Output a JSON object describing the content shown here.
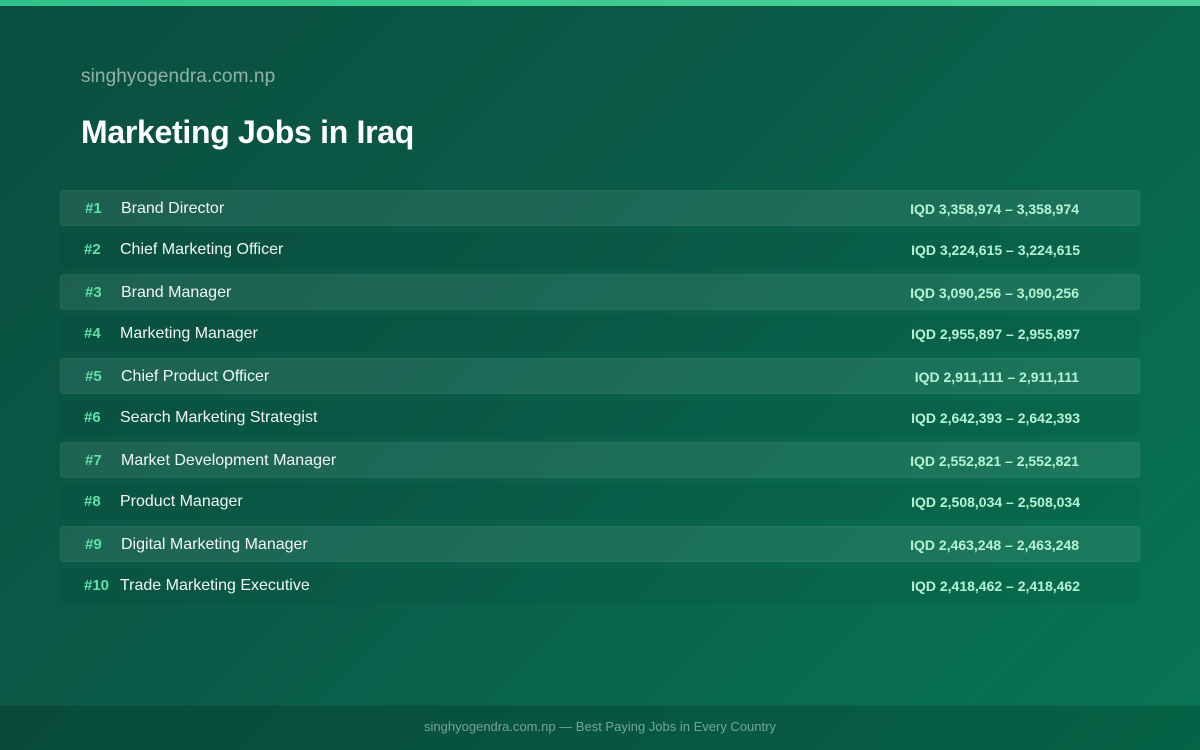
{
  "header": {
    "site_name": "singhyogendra.com.np",
    "title": "Marketing Jobs in Iraq"
  },
  "jobs": [
    {
      "rank": "#1",
      "title": "Brand Director",
      "salary": "IQD 3,358,974 – 3,358,974"
    },
    {
      "rank": "#2",
      "title": "Chief Marketing Officer",
      "salary": "IQD 3,224,615 – 3,224,615"
    },
    {
      "rank": "#3",
      "title": "Brand Manager",
      "salary": "IQD 3,090,256 – 3,090,256"
    },
    {
      "rank": "#4",
      "title": "Marketing Manager",
      "salary": "IQD 2,955,897 – 2,955,897"
    },
    {
      "rank": "#5",
      "title": "Chief Product Officer",
      "salary": "IQD 2,911,111 – 2,911,111"
    },
    {
      "rank": "#6",
      "title": "Search Marketing Strategist",
      "salary": "IQD 2,642,393 – 2,642,393"
    },
    {
      "rank": "#7",
      "title": "Market Development Manager",
      "salary": "IQD 2,552,821 – 2,552,821"
    },
    {
      "rank": "#8",
      "title": "Product Manager",
      "salary": "IQD 2,508,034 – 2,508,034"
    },
    {
      "rank": "#9",
      "title": "Digital Marketing Manager",
      "salary": "IQD 2,463,248 – 2,463,248"
    },
    {
      "rank": "#10",
      "title": "Trade Marketing Executive",
      "salary": "IQD 2,418,462 – 2,418,462"
    }
  ],
  "footer": {
    "text": "singhyogendra.com.np — Best Paying Jobs in Every Country"
  },
  "colors": {
    "background": "#0a5c48",
    "accent": "#2fc28a",
    "rank": "#5fe0a6",
    "salary": "#b6f3d4"
  }
}
